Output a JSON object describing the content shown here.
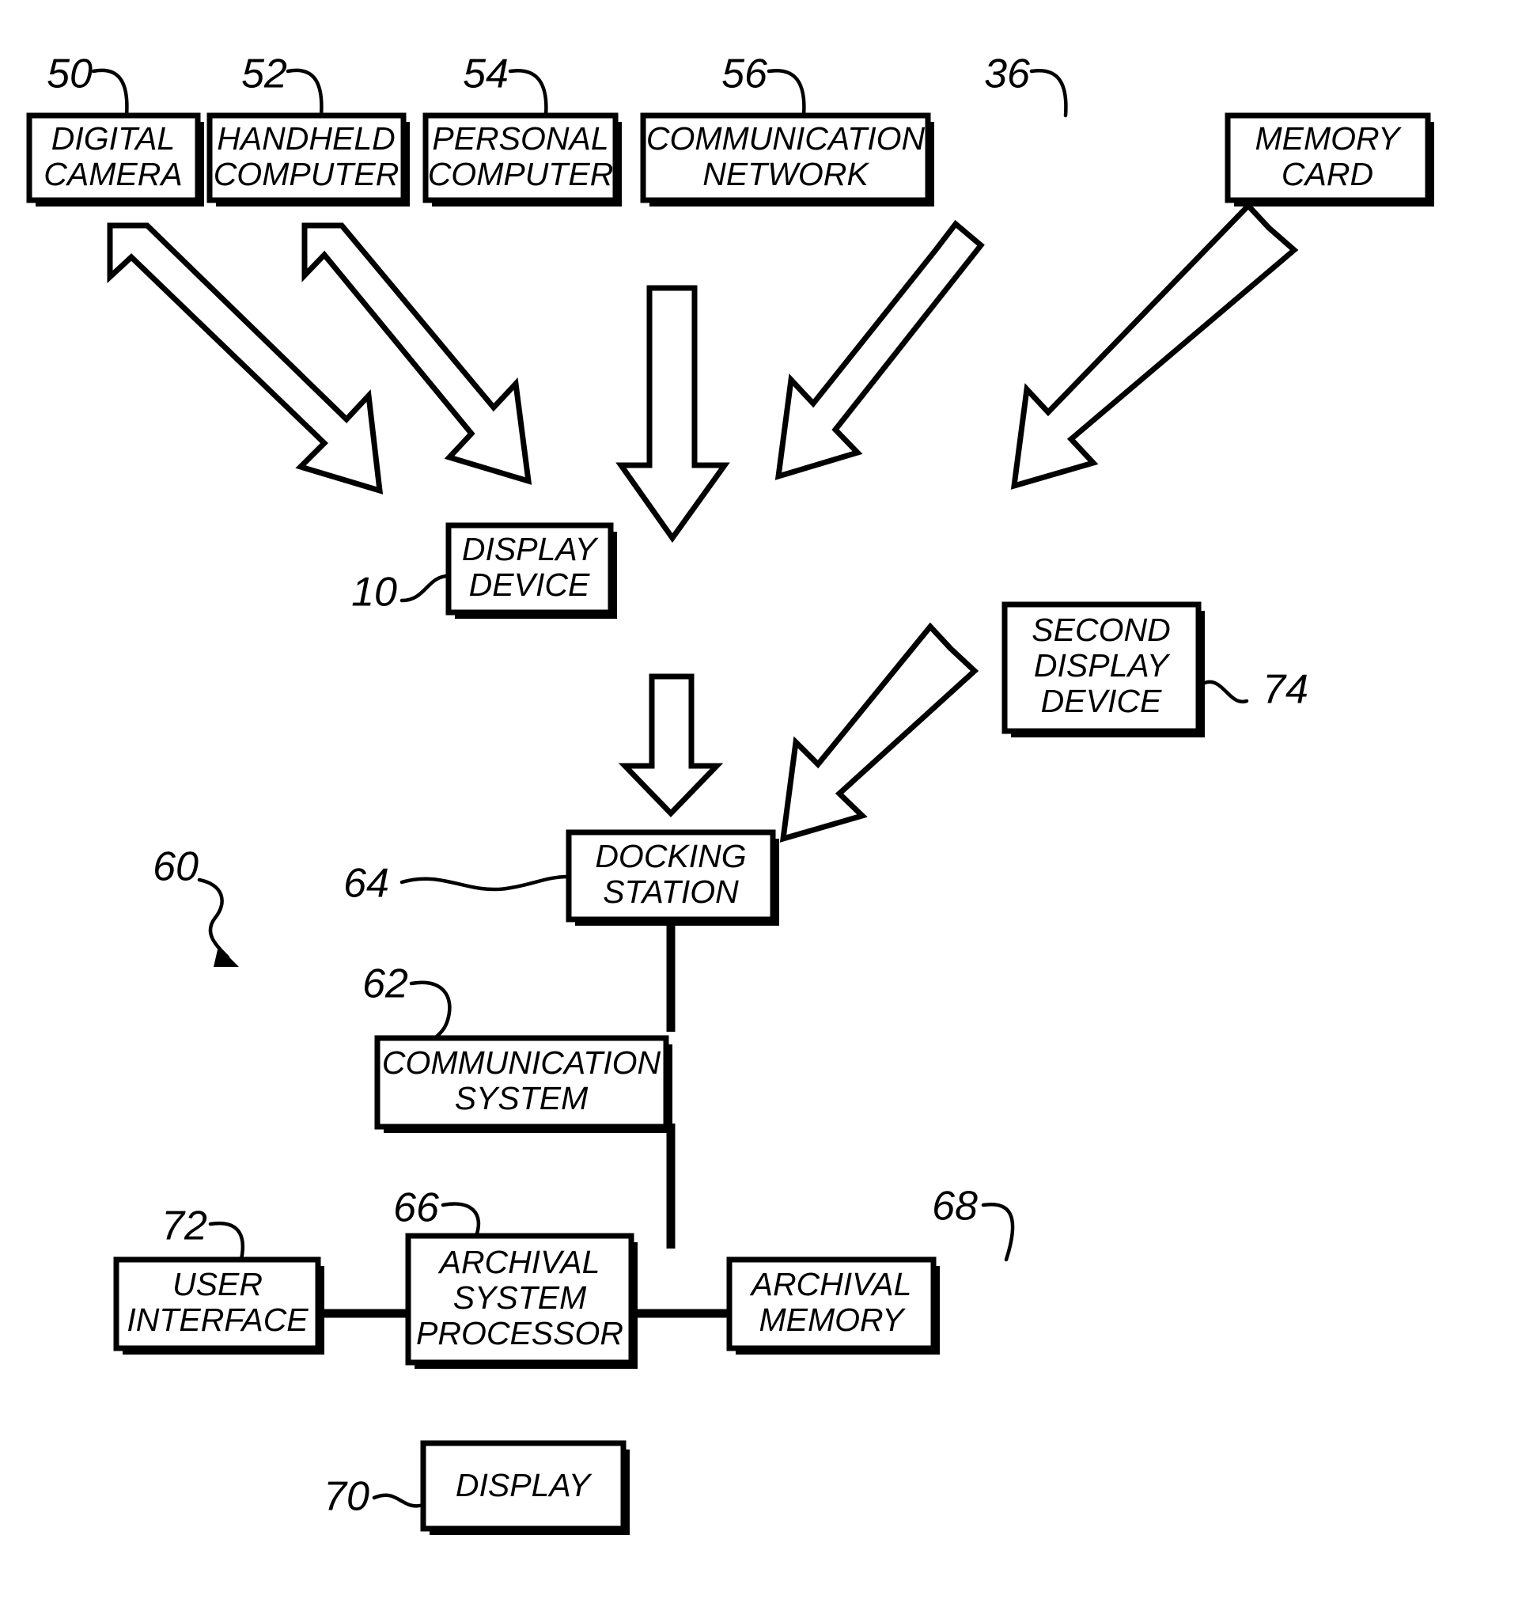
{
  "figure": {
    "type": "patent-block-diagram",
    "system_reference": "60",
    "background_color": "#ffffff",
    "line_color": "#000000"
  },
  "blocks": [
    {
      "id": "digital-camera",
      "ref": "50",
      "lines": [
        "DIGITAL",
        "CAMERA"
      ]
    },
    {
      "id": "handheld-computer",
      "ref": "52",
      "lines": [
        "HANDHELD",
        "COMPUTER"
      ]
    },
    {
      "id": "personal-computer",
      "ref": "54",
      "lines": [
        "PERSONAL",
        "COMPUTER"
      ]
    },
    {
      "id": "communication-network",
      "ref": "56",
      "lines": [
        "COMMUNICATION",
        "NETWORK"
      ]
    },
    {
      "id": "memory-card",
      "ref": "36",
      "lines": [
        "MEMORY",
        "CARD"
      ]
    },
    {
      "id": "display-device",
      "ref": "10",
      "lines": [
        "DISPLAY",
        "DEVICE"
      ]
    },
    {
      "id": "second-display-device",
      "ref": "74",
      "lines": [
        "SECOND",
        "DISPLAY",
        "DEVICE"
      ]
    },
    {
      "id": "docking-station",
      "ref": "64",
      "lines": [
        "DOCKING",
        "STATION"
      ]
    },
    {
      "id": "communication-system",
      "ref": "62",
      "lines": [
        "COMMUNICATION",
        "SYSTEM"
      ]
    },
    {
      "id": "user-interface",
      "ref": "72",
      "lines": [
        "USER",
        "INTERFACE"
      ]
    },
    {
      "id": "archival-system-processor",
      "ref": "66",
      "lines": [
        "ARCHIVAL",
        "SYSTEM",
        "PROCESSOR"
      ]
    },
    {
      "id": "archival-memory",
      "ref": "68",
      "lines": [
        "ARCHIVAL",
        "MEMORY"
      ]
    },
    {
      "id": "display",
      "ref": "70",
      "lines": [
        "DISPLAY"
      ]
    }
  ],
  "flows": [
    {
      "from": "digital-camera",
      "to": "display-device",
      "style": "block-arrow-diagonal"
    },
    {
      "from": "handheld-computer",
      "to": "display-device",
      "style": "block-arrow-diagonal"
    },
    {
      "from": "personal-computer",
      "to": "display-device",
      "style": "block-arrow-vertical"
    },
    {
      "from": "communication-network",
      "to": "display-device",
      "style": "block-arrow-diagonal"
    },
    {
      "from": "memory-card",
      "to": "display-device",
      "style": "block-arrow-diagonal"
    },
    {
      "from": "display-device",
      "to": "docking-station",
      "style": "block-arrow-vertical"
    },
    {
      "from": "second-display-device",
      "to": "docking-station",
      "style": "block-arrow-diagonal"
    },
    {
      "from": "docking-station",
      "to": "communication-system",
      "style": "line"
    },
    {
      "from": "communication-system",
      "to": "archival-system-processor",
      "style": "line"
    },
    {
      "from": "user-interface",
      "to": "archival-system-processor",
      "style": "line"
    },
    {
      "from": "archival-system-processor",
      "to": "archival-memory",
      "style": "line"
    }
  ]
}
